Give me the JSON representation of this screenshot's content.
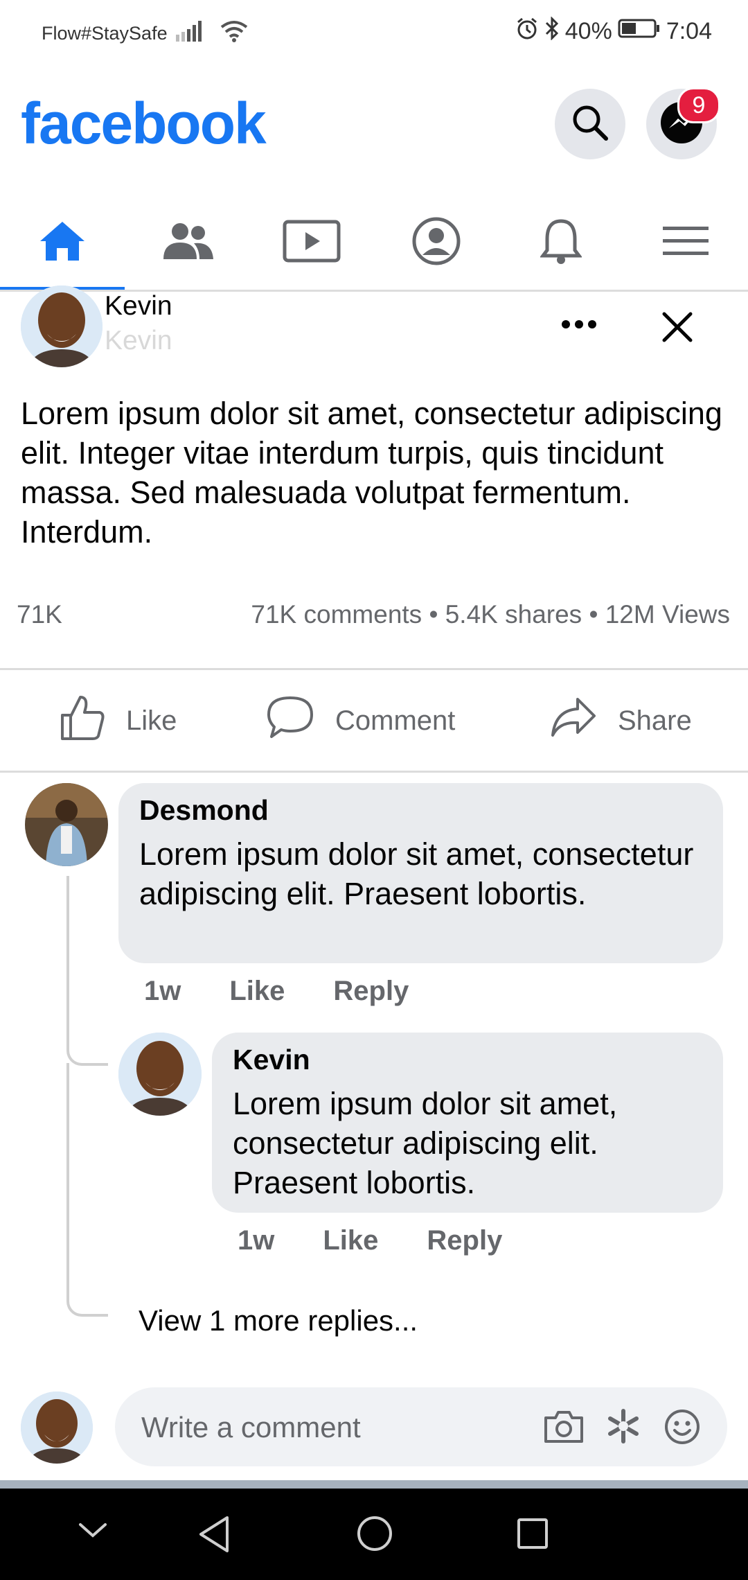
{
  "status_bar": {
    "carrier": "Flow#StaySafe",
    "battery": "40%",
    "time": "7:04"
  },
  "header": {
    "logo": "facebook",
    "messenger_badge": "9"
  },
  "tabs": [
    "home-icon",
    "friends-icon",
    "watch-icon",
    "profile-icon",
    "notifications-icon",
    "menu-icon"
  ],
  "post": {
    "author": "Kevin",
    "subtitle": "Kevin",
    "text": "Lorem ipsum dolor sit amet, consectetur adipiscing elit. Integer vitae interdum turpis, quis tincidunt massa. Sed malesuada volutpat fermentum. Interdum.",
    "reactions": "71K",
    "comments": "71K comments",
    "shares": "5.4K shares",
    "views": "12M Views",
    "separator": "•"
  },
  "actions": {
    "like": "Like",
    "comment": "Comment",
    "share": "Share"
  },
  "comments": [
    {
      "author": "Desmond",
      "text": "Lorem ipsum dolor sit amet, consectetur adipiscing elit. Praesent lobortis.",
      "time": "1w",
      "like": "Like",
      "reply": "Reply"
    },
    {
      "author": "Kevin",
      "text": "Lorem ipsum dolor sit amet, consectetur adipiscing elit. Praesent lobortis.",
      "time": "1w",
      "like": "Like",
      "reply": "Reply"
    }
  ],
  "view_more": "View 1 more replies...",
  "composer": {
    "placeholder": "Write a comment"
  },
  "colors": {
    "brand": "#1877f2",
    "badge": "#e41e3f",
    "bubble": "#e9ebee",
    "muted": "#65676b"
  }
}
